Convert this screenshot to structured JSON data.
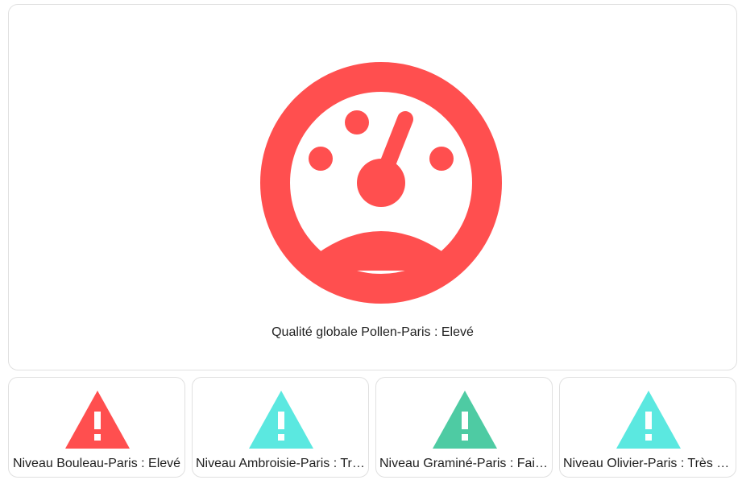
{
  "main": {
    "label": "Qualité globale Pollen-Paris : Elevé",
    "icon": "gauge-icon",
    "color": "#ff4f4f"
  },
  "tiles": [
    {
      "label": "Niveau Bouleau-Paris : Elevé",
      "icon": "alert-icon",
      "color": "#ff4f4f"
    },
    {
      "label": "Niveau Ambroisie-Paris : Très faible",
      "icon": "alert-icon",
      "color": "#5be8e0"
    },
    {
      "label": "Niveau Graminé-Paris : Faible",
      "icon": "alert-icon",
      "color": "#4ecba3"
    },
    {
      "label": "Niveau Olivier-Paris : Très faible",
      "icon": "alert-icon",
      "color": "#5be8e0"
    }
  ]
}
